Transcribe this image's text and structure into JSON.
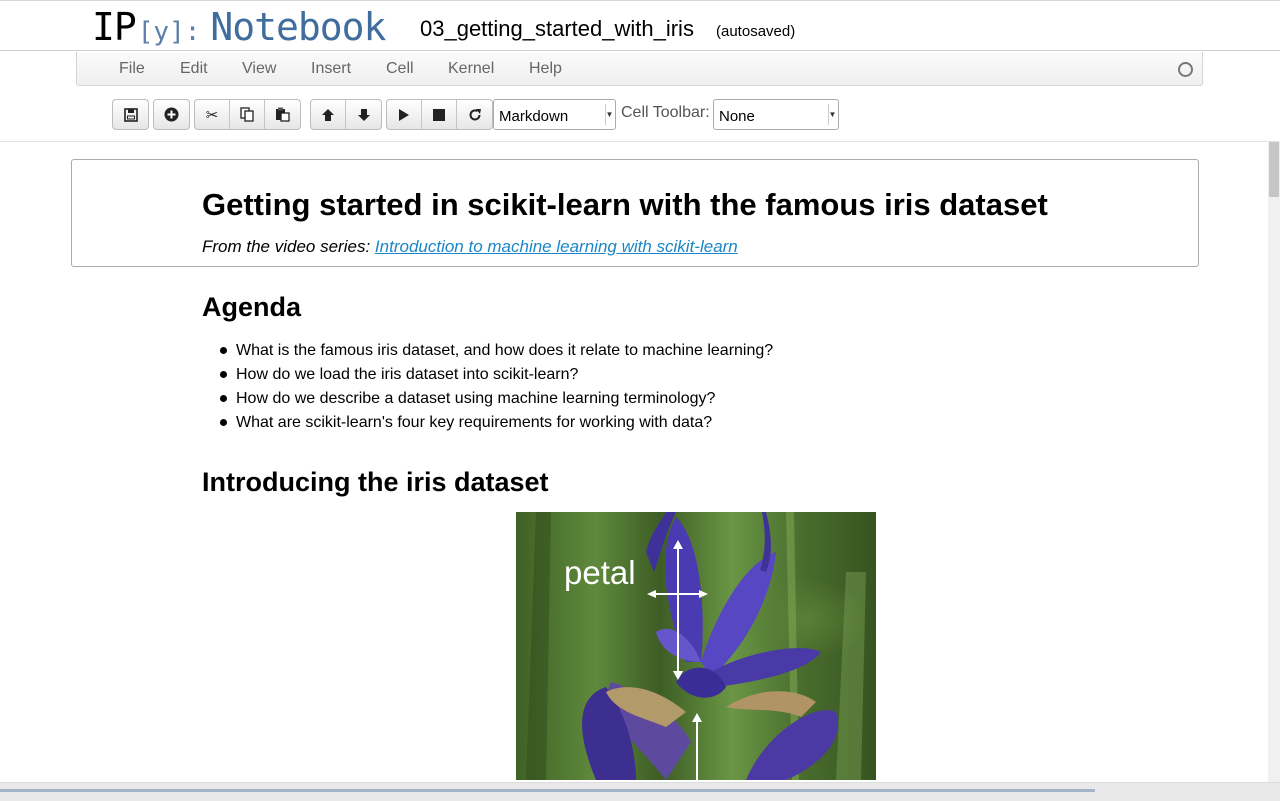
{
  "header": {
    "logo": {
      "ip": "IP",
      "y": "[y]:",
      "notebook": "Notebook"
    },
    "notebook_name": "03_getting_started_with_iris",
    "autosave_status": "(autosaved)"
  },
  "menubar": {
    "items": [
      "File",
      "Edit",
      "View",
      "Insert",
      "Cell",
      "Kernel",
      "Help"
    ]
  },
  "toolbar": {
    "buttons": [
      "save-icon",
      "insert-cell-below-icon",
      "cut-icon",
      "copy-icon",
      "paste-icon",
      "move-up-icon",
      "move-down-icon",
      "run-icon",
      "stop-icon",
      "restart-icon"
    ],
    "cell_type": "Markdown",
    "cell_toolbar_label": "Cell Toolbar:",
    "cell_toolbar_value": "None"
  },
  "notebook": {
    "title": "Getting started in scikit-learn with the famous iris dataset",
    "subtitle_prefix": "From the video series:",
    "subtitle_link": "Introduction to machine learning with scikit-learn",
    "agenda_heading": "Agenda",
    "agenda_items": [
      "What is the famous iris dataset, and how does it relate to machine learning?",
      "How do we load the iris dataset into scikit-learn?",
      "How do we describe a dataset using machine learning terminology?",
      "What are scikit-learn's four key requirements for working with data?"
    ],
    "intro_heading": "Introducing the iris dataset",
    "figure_label": "petal"
  },
  "colors": {
    "link": "#1a86c8",
    "logo_blue": "#3f6d9d",
    "flower_purple": "#4a3aa8"
  }
}
